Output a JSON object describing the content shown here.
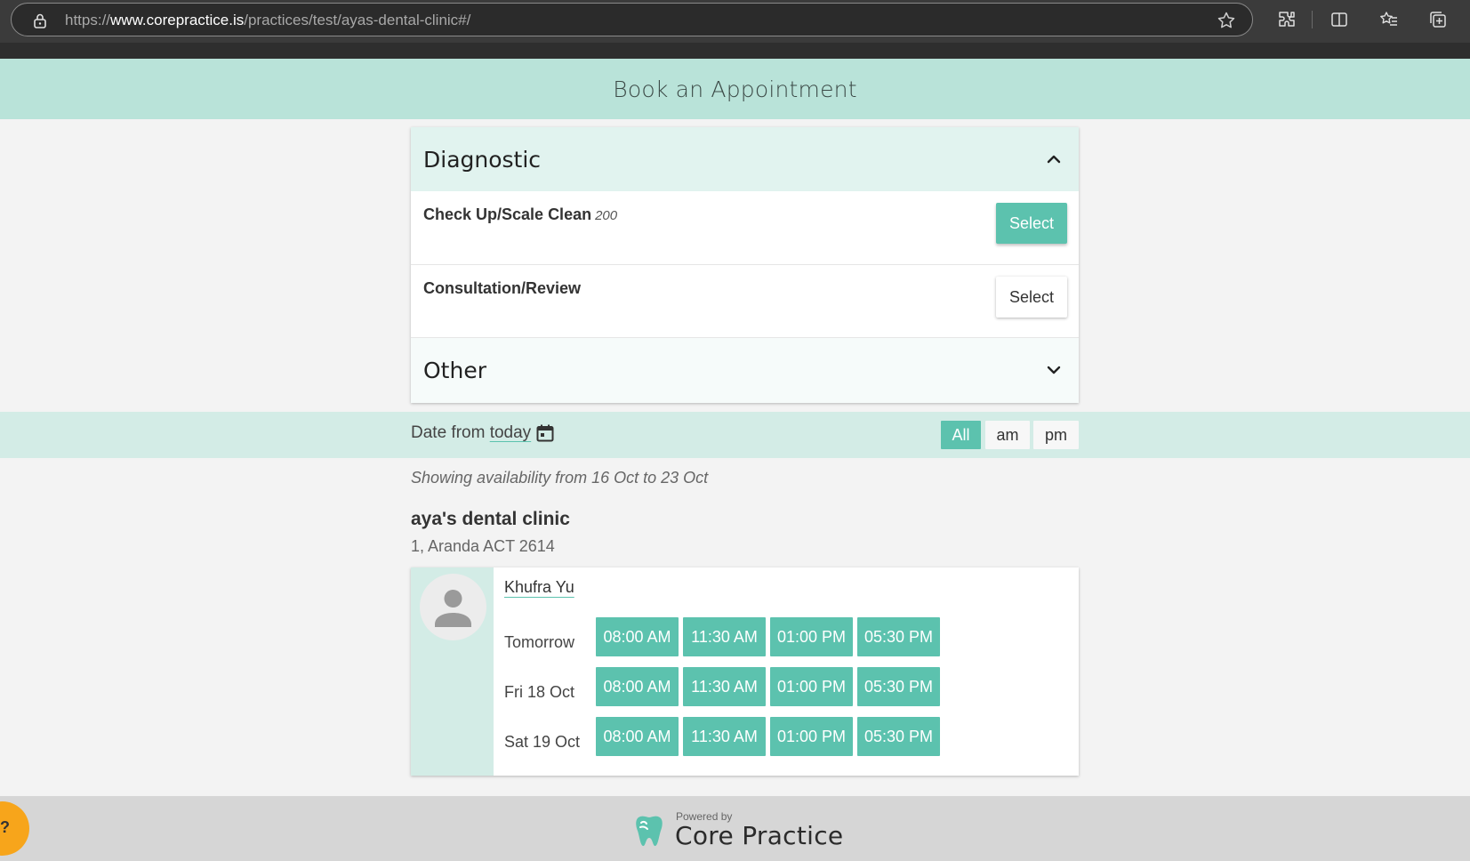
{
  "browser": {
    "url_scheme": "https://",
    "url_domain": "www.corepractice.is",
    "url_path": "/practices/test/ayas-dental-clinic#/"
  },
  "header": {
    "title": "Book an Appointment"
  },
  "services": {
    "groups": [
      {
        "label": "Diagnostic",
        "expanded": true,
        "items": [
          {
            "name": "Check Up/Scale Clean",
            "price": "200",
            "button": "Select",
            "selected": true
          },
          {
            "name": "Consultation/Review",
            "price": "",
            "button": "Select",
            "selected": false
          }
        ]
      },
      {
        "label": "Other",
        "expanded": false
      }
    ]
  },
  "date_filter": {
    "prefix": "Date from",
    "link": "today",
    "periods": [
      "All",
      "am",
      "pm"
    ],
    "active_period": "All"
  },
  "availability_note": "Showing availability from 16 Oct to 23 Oct",
  "clinic": {
    "name": "aya's dental clinic",
    "address": "1, Aranda ACT 2614"
  },
  "practitioner": {
    "name": "Khufra Yu",
    "days": [
      {
        "label": "Tomorrow",
        "slots": [
          "08:00 AM",
          "11:30 AM",
          "01:00 PM",
          "05:30 PM"
        ]
      },
      {
        "label": "Fri 18 Oct",
        "slots": [
          "08:00 AM",
          "11:30 AM",
          "01:00 PM",
          "05:30 PM"
        ]
      },
      {
        "label": "Sat 19 Oct",
        "slots": [
          "08:00 AM",
          "11:30 AM",
          "01:00 PM",
          "05:30 PM"
        ]
      }
    ]
  },
  "footer": {
    "powered_by": "Powered by",
    "brand": "Core Practice"
  },
  "colors": {
    "accent": "#5cc2ae",
    "header_bg": "#b9e3d9",
    "help_bubble": "#f7a51b"
  }
}
